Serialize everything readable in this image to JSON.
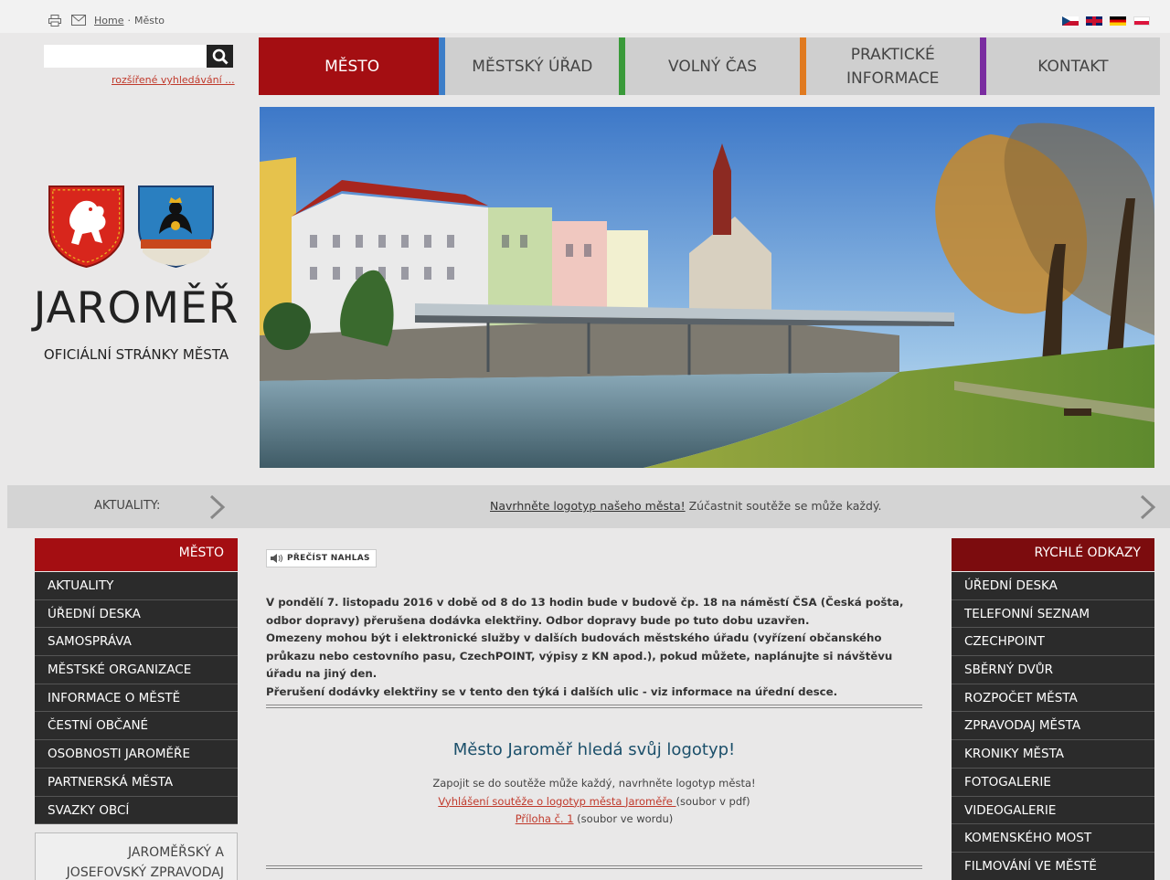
{
  "breadcrumb": {
    "home": "Home",
    "separator": "·",
    "current": "Město"
  },
  "search": {
    "placeholder": "",
    "advanced_link": "rozšířené vyhledávání ..."
  },
  "nav": {
    "items": [
      {
        "line1": "MĚSTO",
        "line2": "",
        "accent": "#a40e12"
      },
      {
        "line1": "MĚSTSKÝ ÚŘAD",
        "line2": "",
        "accent": "#3d7ec8"
      },
      {
        "line1": "VOLNÝ ČAS",
        "line2": "",
        "accent": "#3a9a3a"
      },
      {
        "line1": "PRAKTICKÉ",
        "line2": "INFORMACE",
        "accent": "#e07a20"
      },
      {
        "line1": "KONTAKT",
        "line2": "",
        "accent": "#7a2ca0"
      }
    ]
  },
  "branding": {
    "town": "JAROMĚŘ",
    "subtitle": "OFICIÁLNÍ STRÁNKY MĚSTA"
  },
  "ticker": {
    "label": "AKTUALITY:",
    "link": "Navrhněte logotyp našeho města!",
    "text": " Zúčastnit soutěže se může každý."
  },
  "left_menu": {
    "title": "MĚSTO",
    "items": [
      "AKTUALITY",
      "ÚŘEDNÍ DESKA",
      "SAMOSPRÁVA",
      "MĚSTSKÉ ORGANIZACE",
      "INFORMACE O MĚSTĚ",
      "ČESTNÍ OBČANÉ",
      "OSOBNOSTI JAROMĚŘE",
      "PARTNERSKÁ MĚSTA",
      "SVAZKY OBCÍ"
    ],
    "box_line1": "JAROMĚŘSKÝ A",
    "box_line2": "JOSEFOVSKÝ ZPRAVODAJ"
  },
  "right_menu": {
    "title": "RYCHLÉ ODKAZY",
    "items": [
      "ÚŘEDNÍ DESKA",
      "TELEFONNÍ SEZNAM",
      "CZECHPOINT",
      "SBĚRNÝ DVŮR",
      "ROZPOČET MĚSTA",
      "ZPRAVODAJ MĚSTA",
      "KRONIKY MĚSTA",
      "FOTOGALERIE",
      "VIDEOGALERIE",
      "KOMENSKÉHO MOST",
      "FILMOVÁNÍ VE MĚSTĚ"
    ]
  },
  "content": {
    "read_aloud": "PŘEČÍST NAHLAS",
    "notice": [
      "V pondělí 7. listopadu 2016 v době od 8 do 13 hodin bude v budově čp. 18 na náměstí ČSA (Česká pošta, odbor dopravy) přerušena dodávka elektřiny. Odbor dopravy bude po tuto dobu uzavřen.",
      "Omezeny mohou být i elektronické služby v dalších budovách městského úřadu (vyřízení občanského průkazu nebo cestovního pasu, CzechPOINT, výpisy z KN apod.), pokud můžete, naplánujte si návštěvu úřadu na jiný den.",
      "Přerušení dodávky elektřiny se v tento den týká i dalších ulic - viz informace na úřední desce."
    ],
    "logo_title": "Město Jaroměř hledá svůj logotyp!",
    "logo_intro": "Zapojit se do soutěže může každý, navrhněte logotyp města!",
    "logo_link1": "Vyhlášení soutěže o logotyp města Jaroměře ",
    "logo_link1_note": "(soubor v pdf)",
    "logo_link2": "Příloha č. 1",
    "logo_link2_note": " (soubor ve wordu)"
  },
  "colors": {
    "brand_red": "#a40e12",
    "menu_dark": "#2b2b2b",
    "title_blue": "#1b4f6a"
  }
}
